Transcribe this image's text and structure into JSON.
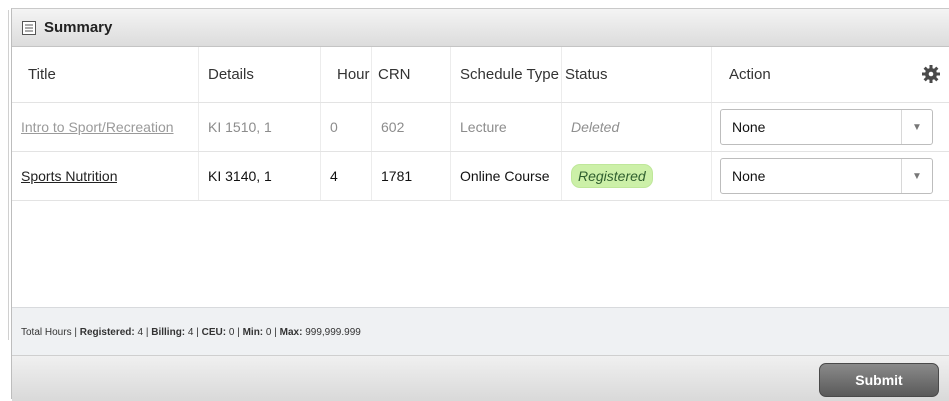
{
  "panel": {
    "title": "Summary",
    "icon": "summary-icon"
  },
  "table": {
    "columns": [
      "Title",
      "Details",
      "Hour",
      "CRN",
      "Schedule Type",
      "Status",
      "Action"
    ],
    "rows": [
      {
        "title": "Intro to Sport/Recreation",
        "details": "KI 1510, 1",
        "hours": "0",
        "crn": "602",
        "schedule_type": "Lecture",
        "status": "Deleted",
        "action": "None"
      },
      {
        "title": "Sports Nutrition",
        "details": "KI 3140, 1",
        "hours": "4",
        "crn": "1781",
        "schedule_type": "Online Course",
        "status": "Registered",
        "action": "None"
      }
    ]
  },
  "totals": {
    "label": "Total Hours",
    "registered_label": "Registered:",
    "registered": "4",
    "billing_label": "Billing:",
    "billing": "4",
    "ceu_label": "CEU:",
    "ceu": "0",
    "min_label": "Min:",
    "min": "0",
    "max_label": "Max:",
    "max": "999,999.999"
  },
  "footer": {
    "submit_label": "Submit"
  },
  "colors": {
    "registered_badge": "#ccf0a8",
    "submit_bg": "#6e6e6e"
  }
}
